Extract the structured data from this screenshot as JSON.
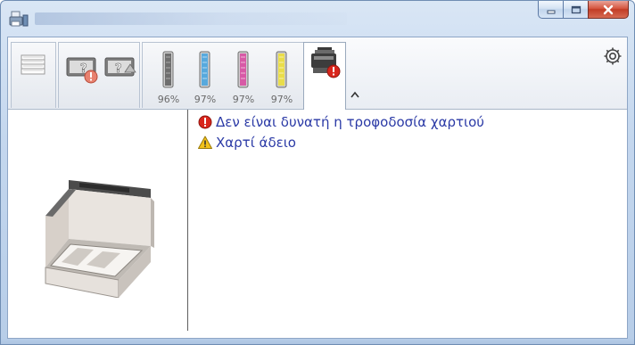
{
  "window": {
    "caption_buttons": {
      "minimize": "minimize-icon",
      "maximize": "maximize-icon",
      "close": "close-icon"
    }
  },
  "tabs": [
    {
      "id": "general",
      "icon": "paper-stack-icon",
      "label": ""
    },
    {
      "id": "paper-error-1",
      "icon": "paper-tray-error-icon",
      "label": ""
    },
    {
      "id": "paper-error-2",
      "icon": "paper-tray-warning-icon",
      "label": ""
    },
    {
      "id": "toner",
      "icon": "toner-cartridge-icon",
      "label": ""
    },
    {
      "id": "device",
      "icon": "printer-error-icon",
      "label": ""
    }
  ],
  "toner": [
    {
      "color_name": "black",
      "color": "#6e6e6e",
      "level": "96%"
    },
    {
      "color_name": "cyan",
      "color": "#57a9dd",
      "level": "97%"
    },
    {
      "color_name": "magenta",
      "color": "#d75aa6",
      "level": "97%"
    },
    {
      "color_name": "yellow",
      "color": "#e9dd4a",
      "level": "97%"
    }
  ],
  "messages": [
    {
      "severity": "error",
      "icon": "error-icon",
      "color": "#d9261c",
      "text": "Δεν είναι δυνατή η τροφοδοσία χαρτιού"
    },
    {
      "severity": "warning",
      "icon": "warning-icon",
      "color": "#f2c21a",
      "text": "Χαρτί άδειο"
    }
  ],
  "colors": {
    "link_text": "#2b3aa6",
    "frame": "#c4d7ee"
  }
}
